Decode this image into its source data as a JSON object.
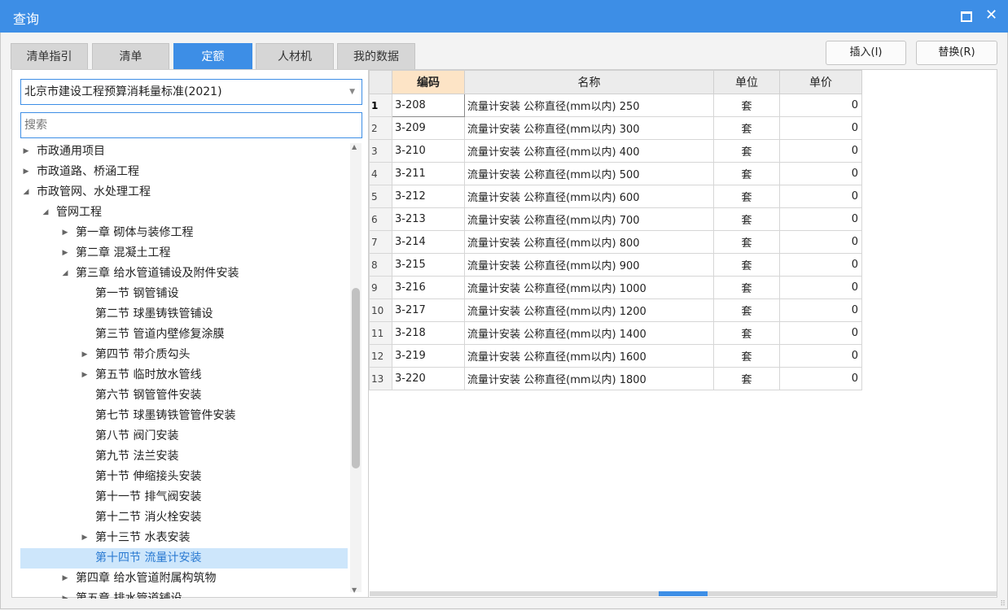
{
  "window": {
    "title": "查询"
  },
  "tabs": [
    {
      "label": "清单指引",
      "active": false
    },
    {
      "label": "清单",
      "active": false
    },
    {
      "label": "定额",
      "active": true
    },
    {
      "label": "人材机",
      "active": false
    },
    {
      "label": "我的数据",
      "active": false
    }
  ],
  "buttons": {
    "insert": "插入(I)",
    "replace": "替换(R)"
  },
  "standard_select": {
    "value": "北京市建设工程预算消耗量标准(2021)"
  },
  "search": {
    "placeholder": "搜索"
  },
  "tree": [
    {
      "label": "市政通用项目",
      "level": 0,
      "expander": "collapsed"
    },
    {
      "label": "市政道路、桥涵工程",
      "level": 0,
      "expander": "collapsed"
    },
    {
      "label": "市政管网、水处理工程",
      "level": 0,
      "expander": "expanded"
    },
    {
      "label": "管网工程",
      "level": 1,
      "expander": "expanded"
    },
    {
      "label": "第一章 砌体与装修工程",
      "level": 2,
      "expander": "collapsed"
    },
    {
      "label": "第二章 混凝土工程",
      "level": 2,
      "expander": "collapsed"
    },
    {
      "label": "第三章 给水管道铺设及附件安装",
      "level": 2,
      "expander": "expanded"
    },
    {
      "label": "第一节 钢管铺设",
      "level": 3,
      "expander": "none"
    },
    {
      "label": "第二节 球墨铸铁管铺设",
      "level": 3,
      "expander": "none"
    },
    {
      "label": "第三节 管道内壁修复涂膜",
      "level": 3,
      "expander": "none"
    },
    {
      "label": "第四节 带介质勾头",
      "level": 3,
      "expander": "collapsed"
    },
    {
      "label": "第五节 临时放水管线",
      "level": 3,
      "expander": "collapsed"
    },
    {
      "label": "第六节 钢管管件安装",
      "level": 3,
      "expander": "none"
    },
    {
      "label": "第七节 球墨铸铁管管件安装",
      "level": 3,
      "expander": "none"
    },
    {
      "label": "第八节 阀门安装",
      "level": 3,
      "expander": "none"
    },
    {
      "label": "第九节 法兰安装",
      "level": 3,
      "expander": "none"
    },
    {
      "label": "第十节 伸缩接头安装",
      "level": 3,
      "expander": "none"
    },
    {
      "label": "第十一节 排气阀安装",
      "level": 3,
      "expander": "none"
    },
    {
      "label": "第十二节 消火栓安装",
      "level": 3,
      "expander": "none"
    },
    {
      "label": "第十三节 水表安装",
      "level": 3,
      "expander": "collapsed"
    },
    {
      "label": "第十四节 流量计安装",
      "level": 3,
      "expander": "none",
      "selected": true
    },
    {
      "label": "第四章 给水管道附属构筑物",
      "level": 2,
      "expander": "collapsed"
    },
    {
      "label": "第五章 排水管道铺设",
      "level": 2,
      "expander": "collapsed"
    }
  ],
  "grid": {
    "headers": [
      "编码",
      "名称",
      "单位",
      "单价"
    ],
    "rows": [
      {
        "n": "1",
        "code": "3-208",
        "name": "流量计安装 公称直径(mm以内) 250",
        "unit": "套",
        "price": "0"
      },
      {
        "n": "2",
        "code": "3-209",
        "name": "流量计安装 公称直径(mm以内) 300",
        "unit": "套",
        "price": "0"
      },
      {
        "n": "3",
        "code": "3-210",
        "name": "流量计安装 公称直径(mm以内) 400",
        "unit": "套",
        "price": "0"
      },
      {
        "n": "4",
        "code": "3-211",
        "name": "流量计安装 公称直径(mm以内) 500",
        "unit": "套",
        "price": "0"
      },
      {
        "n": "5",
        "code": "3-212",
        "name": "流量计安装 公称直径(mm以内) 600",
        "unit": "套",
        "price": "0"
      },
      {
        "n": "6",
        "code": "3-213",
        "name": "流量计安装 公称直径(mm以内) 700",
        "unit": "套",
        "price": "0"
      },
      {
        "n": "7",
        "code": "3-214",
        "name": "流量计安装 公称直径(mm以内) 800",
        "unit": "套",
        "price": "0"
      },
      {
        "n": "8",
        "code": "3-215",
        "name": "流量计安装 公称直径(mm以内) 900",
        "unit": "套",
        "price": "0"
      },
      {
        "n": "9",
        "code": "3-216",
        "name": "流量计安装 公称直径(mm以内) 1000",
        "unit": "套",
        "price": "0"
      },
      {
        "n": "10",
        "code": "3-217",
        "name": "流量计安装 公称直径(mm以内) 1200",
        "unit": "套",
        "price": "0"
      },
      {
        "n": "11",
        "code": "3-218",
        "name": "流量计安装 公称直径(mm以内) 1400",
        "unit": "套",
        "price": "0"
      },
      {
        "n": "12",
        "code": "3-219",
        "name": "流量计安装 公称直径(mm以内) 1600",
        "unit": "套",
        "price": "0"
      },
      {
        "n": "13",
        "code": "3-220",
        "name": "流量计安装 公称直径(mm以内) 1800",
        "unit": "套",
        "price": "0"
      }
    ]
  },
  "colors": {
    "accent": "#3d8ee6",
    "selected_bg": "#cde6fb",
    "sorted_header": "#fde4c6"
  }
}
